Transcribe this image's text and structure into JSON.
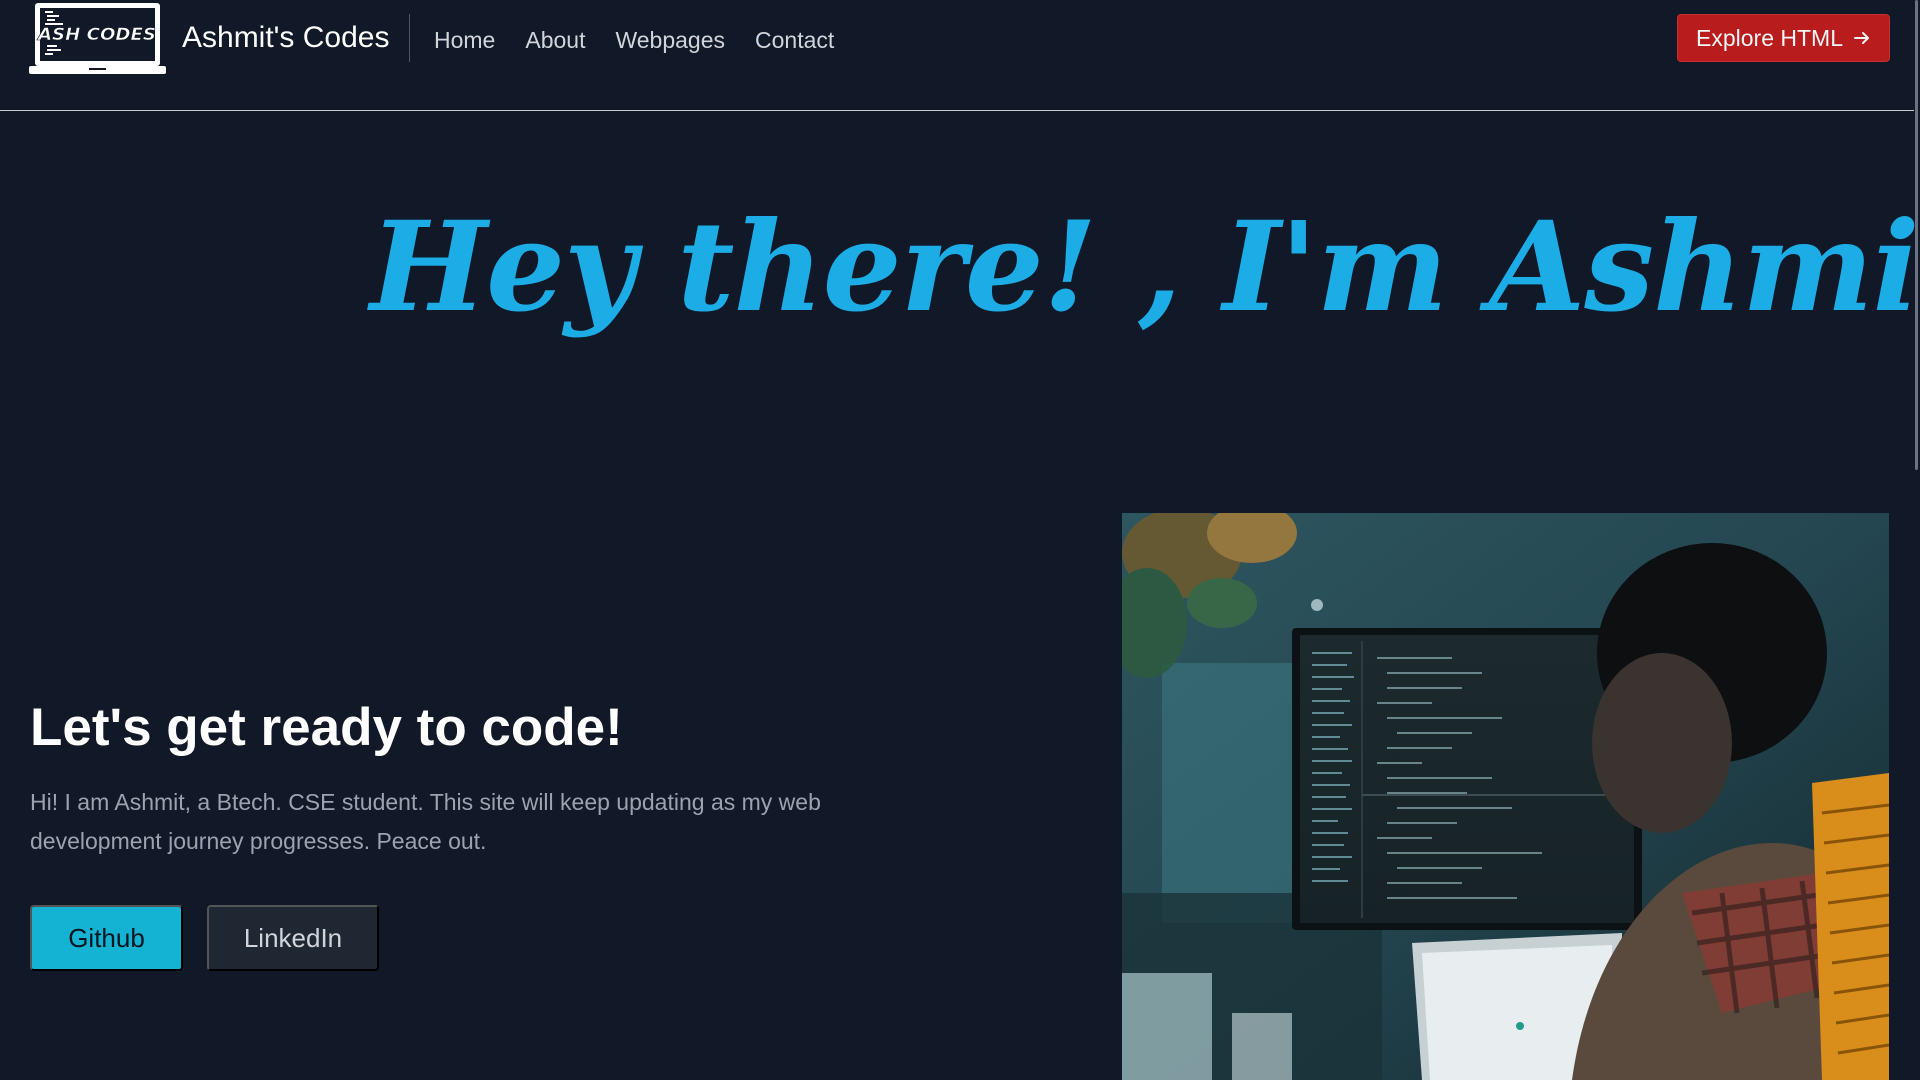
{
  "navbar": {
    "logo": {
      "text": "ASH CODES",
      "icon": "laptop-logo-icon"
    },
    "brand_name": "Ashmit's Codes",
    "links": [
      {
        "label": "Home"
      },
      {
        "label": "About"
      },
      {
        "label": "Webpages"
      },
      {
        "label": "Contact"
      }
    ],
    "cta": {
      "label": "Explore HTML",
      "icon": "arrow-right-icon",
      "color": "#b91c1c"
    }
  },
  "hero": {
    "heading": "Hey there! , I'm Ashmit",
    "color": "#1cace6"
  },
  "intro": {
    "title": "Let's get ready to code!",
    "text": "Hi! I am Ashmit, a Btech. CSE student. This site will keep updating as my web development journey progresses. Peace out.",
    "buttons": {
      "github": {
        "label": "Github",
        "color": "#14b3d4"
      },
      "linkedin": {
        "label": "LinkedIn",
        "color": "#1f2733"
      }
    }
  },
  "theme": {
    "background": "#111827"
  }
}
